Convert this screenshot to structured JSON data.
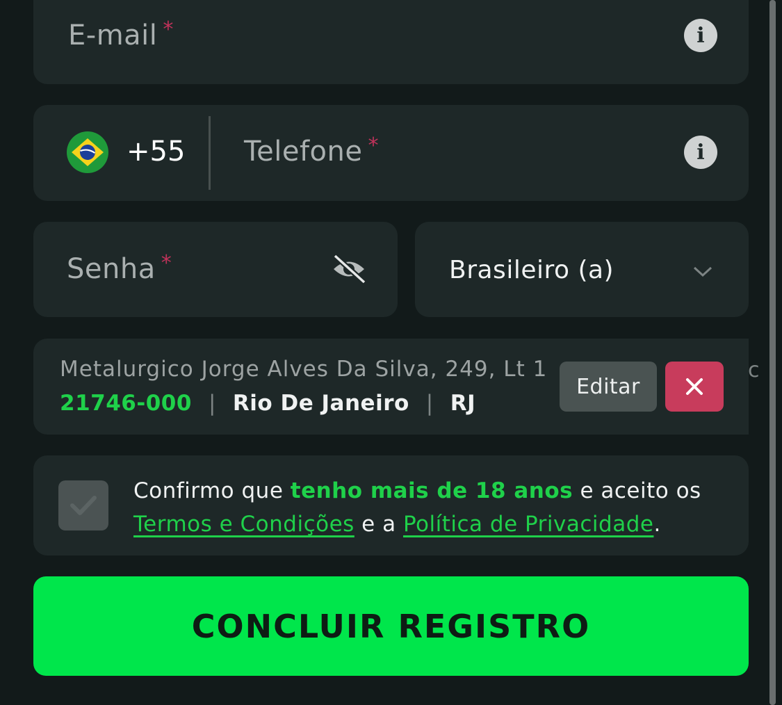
{
  "email": {
    "placeholder": "E-mail",
    "required_mark": "*"
  },
  "phone": {
    "country_code": "+55",
    "placeholder": "Telefone",
    "required_mark": "*"
  },
  "password": {
    "placeholder": "Senha",
    "required_mark": "*"
  },
  "nationality": {
    "selected": "Brasileiro (a)"
  },
  "address": {
    "line": "Metalurgico Jorge Alves Da Silva, 249, Lt 1",
    "zip": "21746-000",
    "city": "Rio De Janeiro",
    "state": "RJ",
    "separator": "|",
    "overflow_hint": "c",
    "edit_label": "Editar"
  },
  "terms": {
    "text_1": "Confirmo que ",
    "highlight": "tenho mais de 18 anos",
    "text_2": " e aceito os ",
    "terms_link": "Termos e Condições",
    "text_3": " e a ",
    "privacy_link": "Política de Privacidade",
    "text_4": "."
  },
  "submit": {
    "label": "CONCLUIR REGISTRO"
  },
  "colors": {
    "background": "#121a1a",
    "card": "#1e2828",
    "accent_green": "#00e64b",
    "required_red": "#c0325a",
    "remove_red": "#c83c5c"
  }
}
